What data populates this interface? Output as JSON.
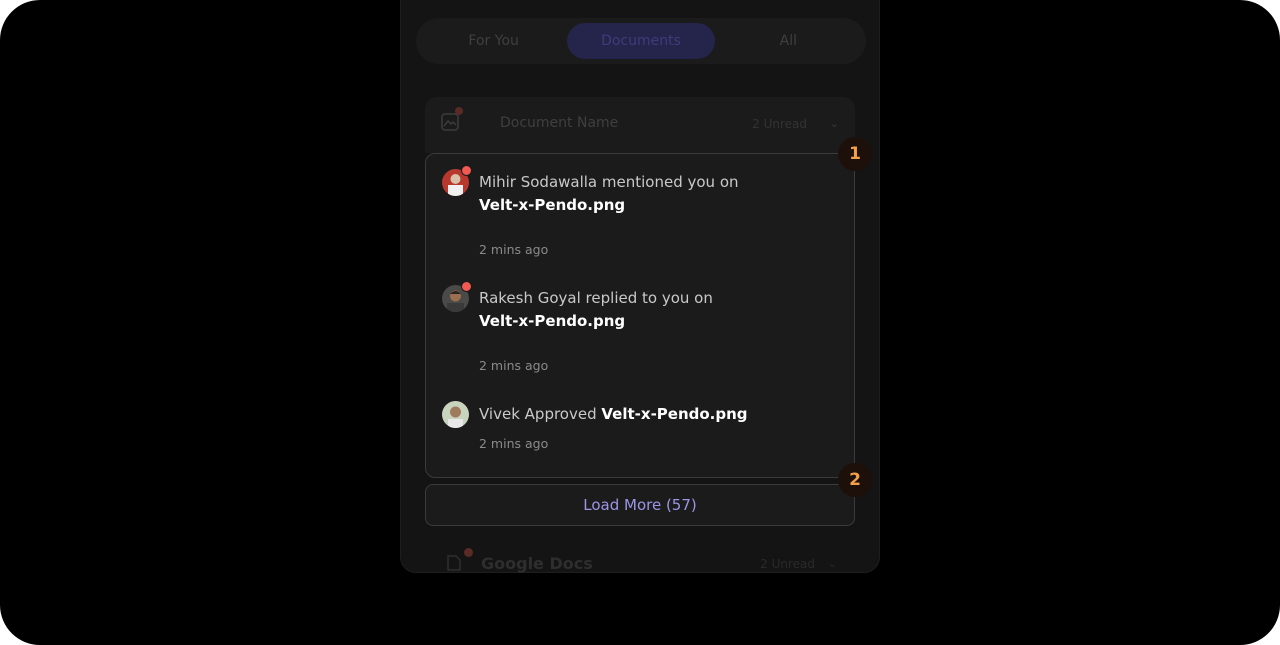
{
  "tabs": [
    {
      "label": "For You",
      "active": false
    },
    {
      "label": "Documents",
      "active": true
    },
    {
      "label": "All",
      "active": false
    }
  ],
  "group": {
    "name": "Document Name",
    "unread": "2 Unread"
  },
  "notifications": [
    {
      "text": "Mihir Sodawalla mentioned you on",
      "file": "Velt-x-Pendo.png",
      "time": "2 mins ago",
      "unread": true
    },
    {
      "text": "Rakesh Goyal replied to you on",
      "file": "Velt-x-Pendo.png",
      "time": "2 mins ago",
      "unread": true
    },
    {
      "text": "Vivek Approved",
      "file": "Velt-x-Pendo.png",
      "time": "2 mins ago",
      "unread": false
    }
  ],
  "load_more": "Load More (57)",
  "badges": [
    "1",
    "2"
  ],
  "group2": {
    "name": "Google Docs",
    "unread": "2 Unread"
  },
  "colors": {
    "accent": "#9c95e6",
    "unread_dot": "#f05a52",
    "badge_text": "#f2a14a"
  }
}
